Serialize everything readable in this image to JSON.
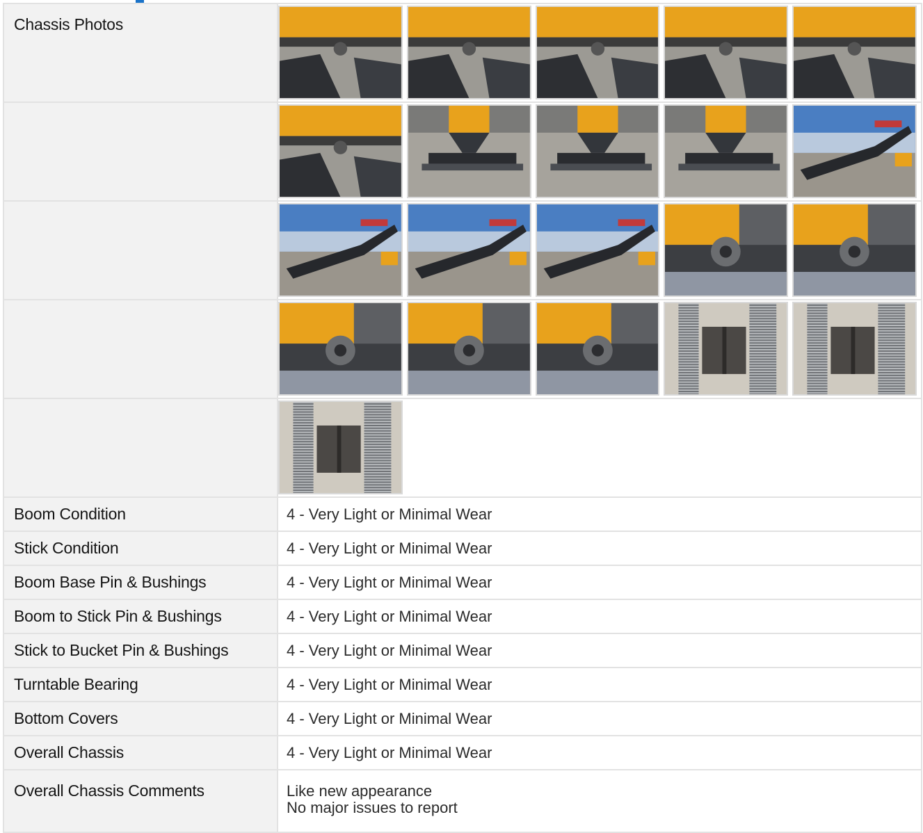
{
  "chassis_photos_label": "Chassis Photos",
  "photo_rows": [
    [
      {
        "name": "chassis-photo-1",
        "scene": "underside"
      },
      {
        "name": "chassis-photo-2",
        "scene": "underside"
      },
      {
        "name": "chassis-photo-3",
        "scene": "underside"
      },
      {
        "name": "chassis-photo-4",
        "scene": "underside"
      },
      {
        "name": "chassis-photo-5",
        "scene": "underside"
      }
    ],
    [
      {
        "name": "chassis-photo-6",
        "scene": "underside"
      },
      {
        "name": "chassis-photo-7",
        "scene": "blade"
      },
      {
        "name": "chassis-photo-8",
        "scene": "blade"
      },
      {
        "name": "chassis-photo-9",
        "scene": "blade"
      },
      {
        "name": "chassis-photo-10",
        "scene": "arm-sky"
      }
    ],
    [
      {
        "name": "chassis-photo-11",
        "scene": "arm-sky"
      },
      {
        "name": "chassis-photo-12",
        "scene": "arm-sky"
      },
      {
        "name": "chassis-photo-13",
        "scene": "arm-sky"
      },
      {
        "name": "chassis-photo-14",
        "scene": "pin"
      },
      {
        "name": "chassis-photo-15",
        "scene": "pin"
      }
    ],
    [
      {
        "name": "chassis-photo-16",
        "scene": "pin"
      },
      {
        "name": "chassis-photo-17",
        "scene": "pin"
      },
      {
        "name": "chassis-photo-18",
        "scene": "pin"
      },
      {
        "name": "chassis-photo-19",
        "scene": "spring"
      },
      {
        "name": "chassis-photo-20",
        "scene": "spring"
      }
    ],
    [
      {
        "name": "chassis-photo-21",
        "scene": "spring"
      }
    ]
  ],
  "conditions": [
    {
      "label": "Boom Condition",
      "value": "4 - Very Light or Minimal Wear"
    },
    {
      "label": "Stick Condition",
      "value": "4 - Very Light or Minimal Wear"
    },
    {
      "label": "Boom Base Pin & Bushings",
      "value": "4 - Very Light or Minimal Wear"
    },
    {
      "label": "Boom to Stick Pin & Bushings",
      "value": "4 - Very Light or Minimal Wear"
    },
    {
      "label": "Stick to Bucket Pin & Bushings",
      "value": "4 - Very Light or Minimal Wear"
    },
    {
      "label": "Turntable Bearing",
      "value": "4 - Very Light or Minimal Wear"
    },
    {
      "label": "Bottom Covers",
      "value": "4 - Very Light or Minimal Wear"
    },
    {
      "label": "Overall Chassis",
      "value": "4 - Very Light or Minimal Wear"
    }
  ],
  "comments": {
    "label": "Overall Chassis Comments",
    "line1": "Like new appearance",
    "line2": "No major issues to report"
  },
  "colors": {
    "accent": "#1a73c9",
    "deere_yellow": "#e8a21c",
    "label_bg": "#f2f2f2",
    "border": "#e2e2e2"
  }
}
